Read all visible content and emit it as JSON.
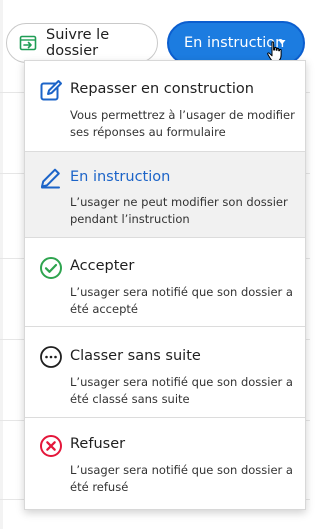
{
  "toolbar": {
    "follow_label": "Suivre le dossier",
    "status_label": "En instruction"
  },
  "menu": {
    "items": [
      {
        "title": "Repasser en construction",
        "desc": "Vous permettrez à l’usager de modifier ses réponses au formulaire",
        "icon": "edit-square-icon",
        "active": false
      },
      {
        "title": "En instruction",
        "desc": "L’usager ne peut modifier son dossier pendant l’instruction",
        "icon": "pencil-icon",
        "active": true
      },
      {
        "title": "Accepter",
        "desc": "L’usager sera notifié que son dossier a été accepté",
        "icon": "check-circle-icon",
        "active": false
      },
      {
        "title": "Classer sans suite",
        "desc": "L’usager sera notifié que son dossier a été classé sans suite",
        "icon": "ellipsis-circle-icon",
        "active": false
      },
      {
        "title": "Refuser",
        "desc": "L’usager sera notifié que son dossier a été refusé",
        "icon": "cross-circle-icon",
        "active": false
      }
    ]
  },
  "colors": {
    "primary": "#1c7ce0",
    "accept": "#2ea44f",
    "refuse": "#e4163a",
    "follow_icon": "#1f9d55"
  }
}
